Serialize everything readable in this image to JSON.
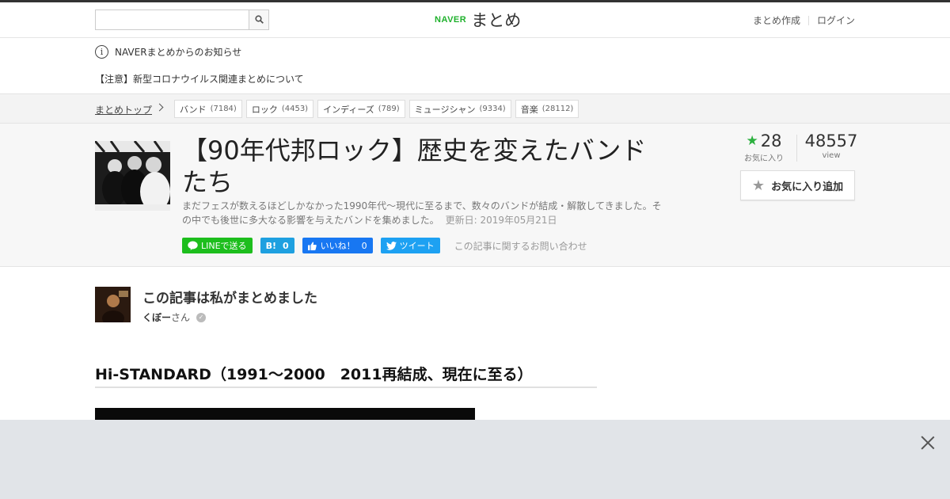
{
  "header": {
    "search": {
      "value": "",
      "placeholder": ""
    },
    "logo": {
      "naver": "NAVER",
      "matome": "まとめ"
    },
    "links": {
      "create": "まとめ作成",
      "login": "ログイン"
    }
  },
  "notices": {
    "info": "NAVERまとめからのお知らせ",
    "covid": "【注意】新型コロナウイルス関連まとめについて"
  },
  "breadcrumb": {
    "home": "まとめトップ",
    "tags": [
      {
        "label": "バンド",
        "count": "(7184)"
      },
      {
        "label": "ロック",
        "count": "(4453)"
      },
      {
        "label": "インディーズ",
        "count": "(789)"
      },
      {
        "label": "ミュージシャン",
        "count": "(9334)"
      },
      {
        "label": "音楽",
        "count": "(28112)"
      }
    ]
  },
  "article": {
    "title": "【90年代邦ロック】歴史を変えたバンドたち",
    "description": "まだフェスが数えるほどしかなかった1990年代～現代に至るまで、数々のバンドが結成・解散してきました。その中でも後世に多大なる影響を与えたバンドを集めました。",
    "updated": "更新日: 2019年05月21日",
    "social": {
      "line": "LINEで送る",
      "hatena_icon": "B!",
      "hatena_count": "0",
      "fb_label": "いいね！",
      "fb_count": "0",
      "tweet": "ツイート"
    },
    "contact": "この記事に関するお問い合わせ",
    "favorites": {
      "count": "28",
      "label": "お気に入り"
    },
    "views": {
      "count": "48557",
      "label": "view"
    },
    "fav_button": "お気に入り追加"
  },
  "author": {
    "heading": "この記事は私がまとめました",
    "name": "くぼー",
    "suffix": "さん"
  },
  "section": {
    "heading": "Hi-STANDARD（1991～2000　2011再結成、現在に至る）"
  },
  "colors": {
    "naver_green": "#1fb12c",
    "line_green": "#1dbe1d",
    "hatena_blue": "#1ea0e0",
    "facebook_blue": "#1877f2",
    "twitter_blue": "#1da1f2",
    "ad_overlay": "#e1e4e8"
  }
}
